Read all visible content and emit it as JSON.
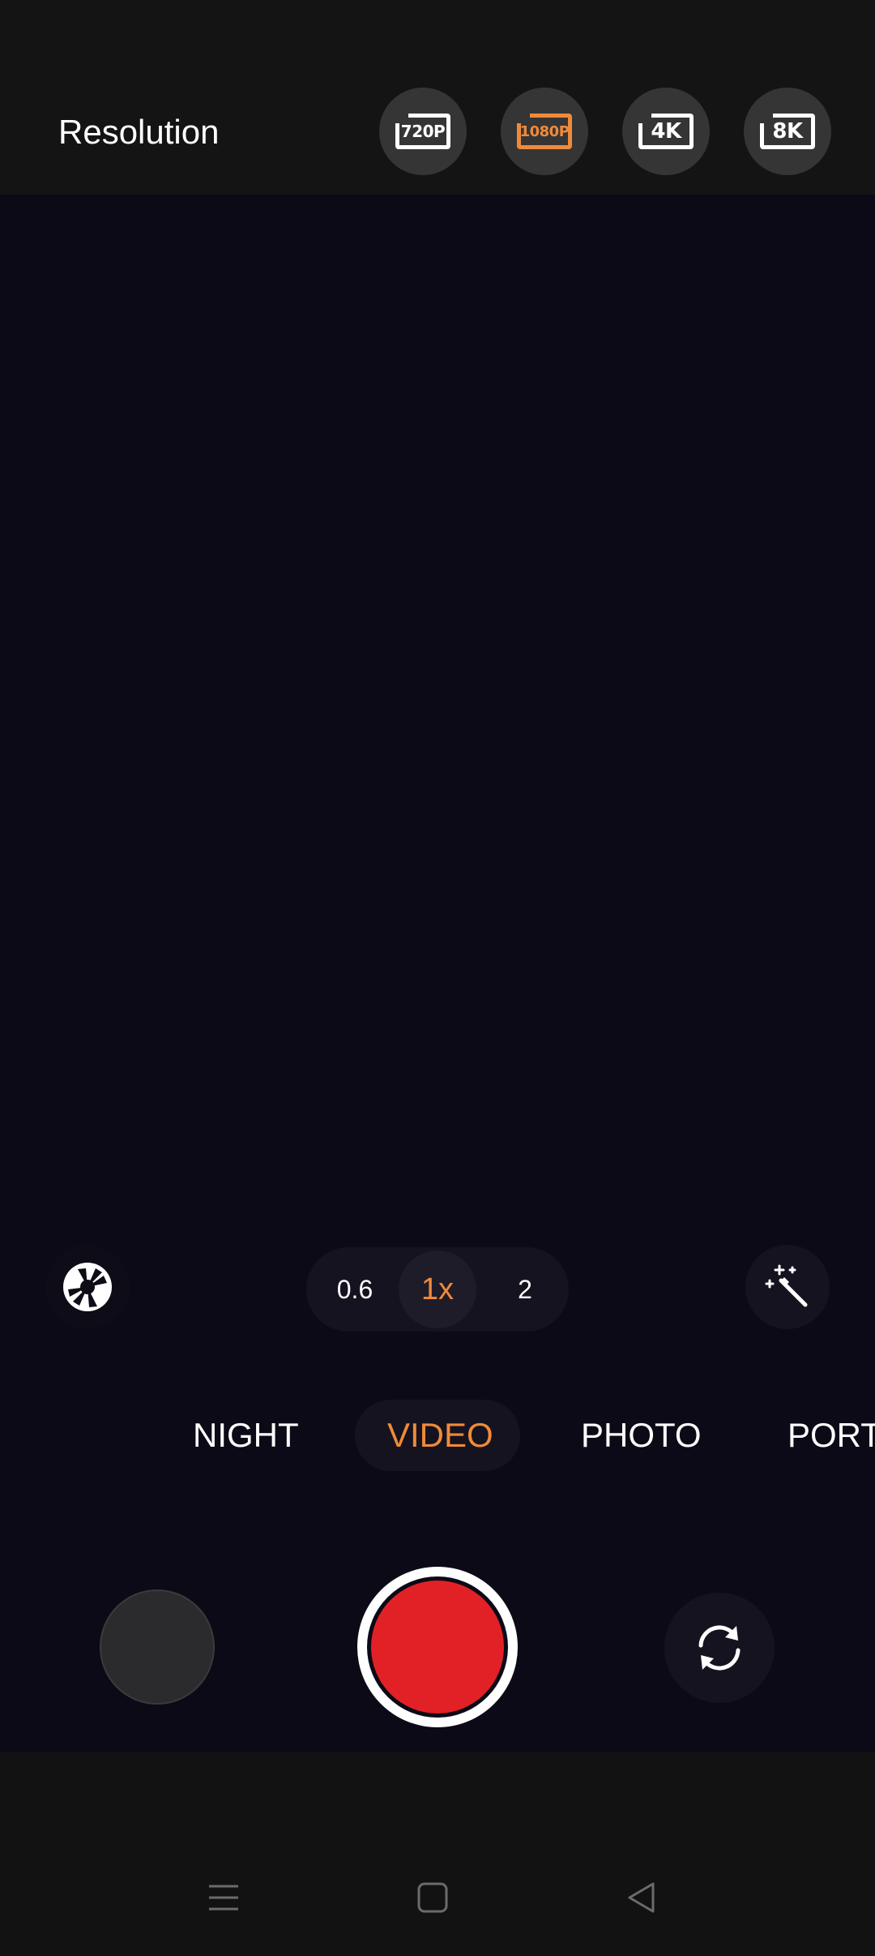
{
  "top_bar": {
    "title": "Resolution",
    "options": [
      {
        "label": "720P",
        "icon": "resolution-720p-icon",
        "selected": false
      },
      {
        "label": "1080P",
        "icon": "resolution-1080p-icon",
        "selected": true
      },
      {
        "label": "4K",
        "icon": "resolution-4k-icon",
        "selected": false
      },
      {
        "label": "8K",
        "icon": "resolution-8k-icon",
        "selected": false
      }
    ]
  },
  "controls": {
    "aperture_icon": "aperture-icon",
    "magic_icon": "magic-wand-icon",
    "zoom": [
      {
        "label": "0.6",
        "selected": false
      },
      {
        "label": "1x",
        "selected": true
      },
      {
        "label": "2",
        "selected": false
      }
    ]
  },
  "modes": [
    {
      "label": "NIGHT",
      "selected": false
    },
    {
      "label": "VIDEO",
      "selected": true
    },
    {
      "label": "PHOTO",
      "selected": false
    },
    {
      "label": "PORT",
      "selected": false
    }
  ],
  "bottom": {
    "gallery_icon": "gallery-thumbnail",
    "shutter_icon": "record-button",
    "flip_icon": "switch-camera-icon"
  },
  "nav": {
    "menu_icon": "menu-icon",
    "home_icon": "home-icon",
    "back_icon": "back-icon"
  },
  "colors": {
    "accent": "#f08a3a",
    "record": "#e22126",
    "viewfinder": "#0c0a16",
    "bar": "#141414"
  }
}
